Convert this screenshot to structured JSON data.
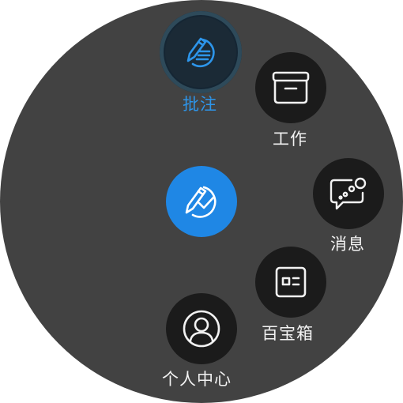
{
  "menu": {
    "items": [
      {
        "label": "批注",
        "icon": "pen-note-icon",
        "active": true
      },
      {
        "label": "工作",
        "icon": "archive-box-icon"
      },
      {
        "label": "消息",
        "icon": "chat-bubble-icon"
      },
      {
        "label": "百宝箱",
        "icon": "toolbox-window-icon"
      },
      {
        "label": "个人中心",
        "icon": "user-profile-icon"
      }
    ],
    "center": {
      "icon": "pen-check-icon"
    }
  },
  "colors": {
    "accent": "#1f87e5",
    "active_label": "#2d95ea",
    "background": "#424242",
    "button": "#1b1b1b",
    "text": "#f2f2f2"
  }
}
